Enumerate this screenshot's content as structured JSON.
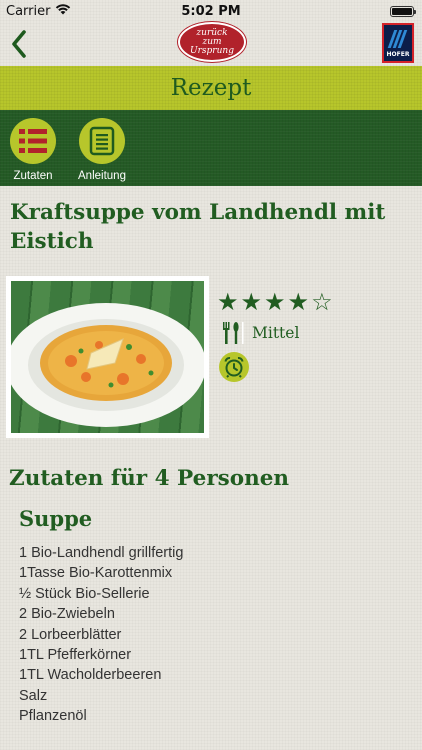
{
  "status_bar": {
    "carrier": "Carrier",
    "time": "5:02 PM",
    "battery_level": 1.0
  },
  "nav": {
    "back_icon": "chevron-left-icon",
    "logo_lines": [
      "zurück",
      "zum",
      "Ursprung"
    ],
    "brand_badge": "HOFER"
  },
  "page": {
    "title": "Rezept"
  },
  "tabs": [
    {
      "label": "Zutaten",
      "icon": "list-icon"
    },
    {
      "label": "Anleitung",
      "icon": "document-icon"
    }
  ],
  "recipe": {
    "title": "Kraftsuppe vom Landhendl mit Eistich",
    "rating": 4,
    "rating_max": 5,
    "difficulty": "Mittel",
    "difficulty_icon": "cutlery-icon",
    "time_icon": "alarm-clock-icon",
    "image_subject": "soup-bowl-photo"
  },
  "ingredients": {
    "heading": "Zutaten für 4 Personen",
    "section": "Suppe",
    "items": [
      "1 Bio-Landhendl grillfertig",
      "1Tasse Bio-Karottenmix",
      "½ Stück Bio-Sellerie",
      "2 Bio-Zwiebeln",
      "2 Lorbeerblätter",
      "1TL Pfefferkörner",
      "1TL Wacholderbeeren",
      "Salz",
      "Pflanzenöl"
    ]
  },
  "colors": {
    "dark_green": "#245a25",
    "lime": "#b7c62b",
    "text_green": "#215d21",
    "logo_red": "#b1222b",
    "hofer_blue": "#0c1e4a"
  }
}
